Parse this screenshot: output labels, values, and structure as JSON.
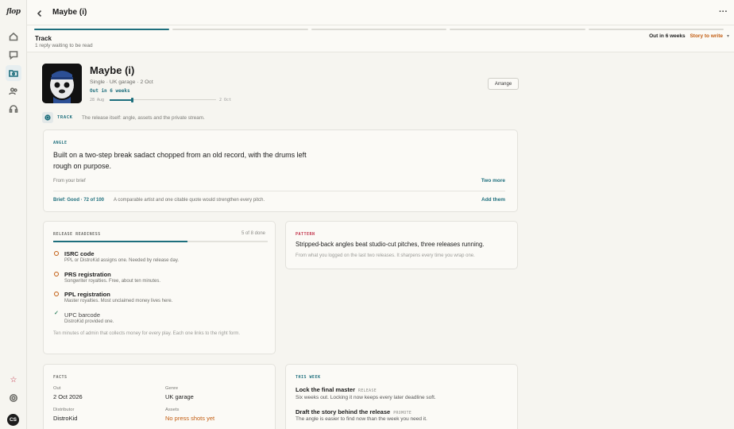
{
  "app": {
    "logo": "flop"
  },
  "header": {
    "title": "Maybe (i)"
  },
  "band": {
    "title": "Track",
    "subtitle": "1 reply waiting to be read",
    "out_label": "Out in 6 weeks",
    "link_label": "Story to write",
    "steps_total": 5,
    "steps_done": 1
  },
  "release": {
    "title": "Maybe (i)",
    "meta": "Single · UK garage · 2 Oct",
    "out": "Out in 6 weeks",
    "timeline_start": "28 Aug",
    "timeline_end": "2 Oct",
    "timeline_progress": 0.21,
    "arrange_label": "Arrange"
  },
  "track": {
    "label": "TRACK",
    "description": "The release itself: angle, assets and the private stream."
  },
  "angle": {
    "kicker": "ANGLE",
    "text": "Built on a two-step break sadact chopped from an old record, with the drums left rough on purpose.",
    "brief": "From your brief",
    "two_more": "Two more",
    "score": "Brief: Good · 72 of 100",
    "hint": "A comparable artist and one citable quote would strengthen every pitch.",
    "add": "Add them"
  },
  "readiness": {
    "kicker": "RELEASE READINESS",
    "count": "5 of 8 done",
    "progress": 0.625,
    "items": [
      {
        "title": "ISRC code",
        "sub": "PPL or DistroKid assigns one. Needed by release day.",
        "done": false
      },
      {
        "title": "PRS registration",
        "sub": "Songwriter royalties. Free, about ten minutes.",
        "done": false
      },
      {
        "title": "PPL registration",
        "sub": "Master royalties. Most unclaimed money lives here.",
        "done": false
      },
      {
        "title": "UPC barcode",
        "sub": "DistroKid provided one.",
        "done": true
      }
    ],
    "footer": "Ten minutes of admin that collects money for every play. Each one links to the right form."
  },
  "pattern": {
    "kicker": "PATTERN",
    "text": "Stripped-back angles beat studio-cut pitches, three releases running.",
    "sub": "From what you logged on the last two releases. It sharpens every time you wrap one."
  },
  "facts": {
    "kicker": "FACTS",
    "out_label": "Out",
    "out_value": "2 Oct 2026",
    "genre_label": "Genre",
    "genre_value": "UK garage",
    "distributor_label": "Distributor",
    "distributor_value": "DistroKid",
    "assets_label": "Assets",
    "assets_value": "No press shots yet"
  },
  "week": {
    "kicker": "THIS WEEK",
    "items": [
      {
        "title": "Lock the final master",
        "tag": "RELEASE",
        "sub": "Six weeks out. Locking it now keeps every later deadline soft."
      },
      {
        "title": "Draft the story behind the release",
        "tag": "PROMOTE",
        "sub": "The angle is easier to find now than the week you need it."
      }
    ]
  },
  "user": {
    "initials": "CS"
  },
  "colors": {
    "accent": "#1e6f7d",
    "warning": "#c25c10",
    "pattern": "#c2334b",
    "background": "#f6f5f0"
  },
  "icons": [
    "home-icon",
    "chat-icon",
    "folder-icon",
    "people-icon",
    "headphones-icon",
    "star-icon",
    "settings-icon"
  ]
}
